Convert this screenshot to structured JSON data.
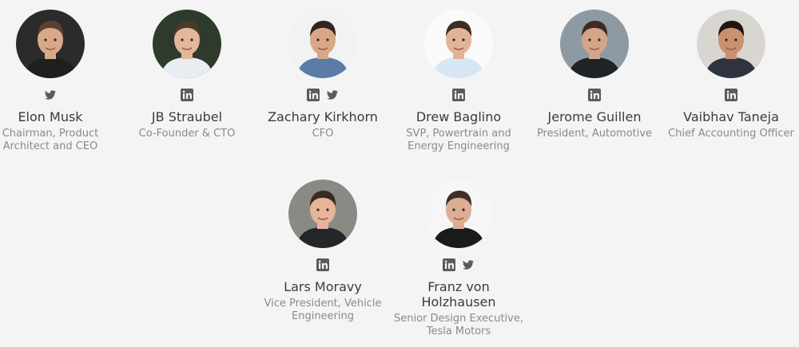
{
  "people": [
    {
      "name": "Elon Musk",
      "role": "Chairman, Product Architect and CEO",
      "icons": [
        "twitter-icon"
      ],
      "bg": "#2b2b2b",
      "skin": "#d9a889",
      "hair": "#5a4030",
      "shirt": "#1f1f1f"
    },
    {
      "name": "JB Straubel",
      "role": "Co-Founder & CTO",
      "icons": [
        "linkedin-icon"
      ],
      "bg": "#2e3b2c",
      "skin": "#e3b79a",
      "hair": "#4a3a2c",
      "shirt": "#e8edf3"
    },
    {
      "name": "Zachary Kirkhorn",
      "role": "CFO",
      "icons": [
        "linkedin-icon",
        "twitter-icon"
      ],
      "bg": "#f2f2f2",
      "skin": "#d9a788",
      "hair": "#2f2620",
      "shirt": "#5a7ca6"
    },
    {
      "name": "Drew Baglino",
      "role": "SVP, Powertrain and Energy Engineering",
      "icons": [
        "linkedin-icon"
      ],
      "bg": "#fafafa",
      "skin": "#e2b497",
      "hair": "#3a2e26",
      "shirt": "#d7e6f5"
    },
    {
      "name": "Jerome Guillen",
      "role": "President, Automotive",
      "icons": [
        "linkedin-icon"
      ],
      "bg": "#8e9aa3",
      "skin": "#d5a589",
      "hair": "#3b2d24",
      "shirt": "#1f2326"
    },
    {
      "name": "Vaibhav Taneja",
      "role": "Chief Accounting Officer",
      "icons": [
        "linkedin-icon"
      ],
      "bg": "#d9d6d2",
      "skin": "#c9916e",
      "hair": "#1d1612",
      "shirt": "#2d3440"
    },
    {
      "name": "Lars Moravy",
      "role": "Vice President, Vehicle Engineering",
      "icons": [
        "linkedin-icon"
      ],
      "bg": "#8a8a84",
      "skin": "#e7b49a",
      "hair": "#3a2b22",
      "shirt": "#24262a"
    },
    {
      "name": "Franz von Holzhausen",
      "role": "Senior Design Executive, Tesla Motors",
      "icons": [
        "linkedin-icon",
        "twitter-icon"
      ],
      "bg": "#f6f6f6",
      "skin": "#dcae92",
      "hair": "#3c3129",
      "shirt": "#1a1a1a"
    }
  ]
}
